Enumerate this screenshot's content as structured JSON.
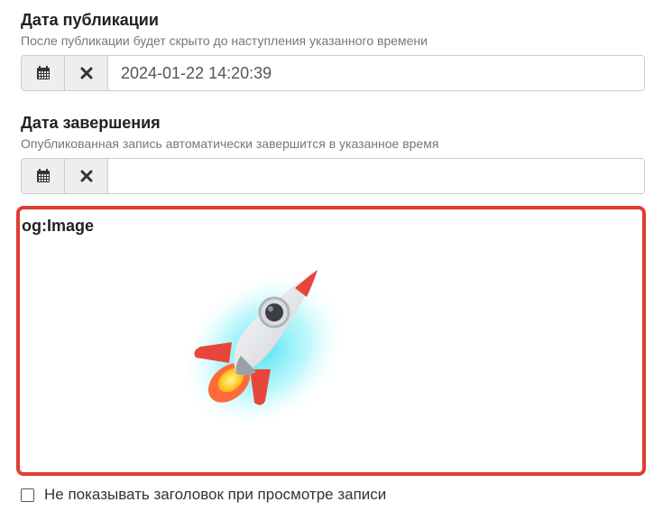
{
  "publish": {
    "label": "Дата публикации",
    "help": "После публикации будет скрыто до наступления указанного времени",
    "value": "2024-01-22 14:20:39",
    "calendar_icon": "calendar-icon",
    "clear_icon": "close-icon"
  },
  "finish": {
    "label": "Дата завершения",
    "help": "Опубликованная запись автоматически завершится в указанное время",
    "value": "",
    "calendar_icon": "calendar-icon",
    "clear_icon": "close-icon"
  },
  "og_image": {
    "label": "og:Image",
    "image": "rocket-image",
    "border_color": "#e03c34"
  },
  "hide_title": {
    "label": "Не показывать заголовок при просмотре записи",
    "checked": false
  }
}
